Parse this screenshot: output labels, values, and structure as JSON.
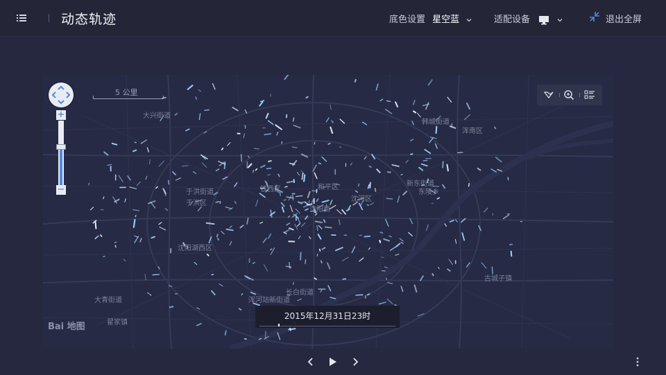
{
  "header": {
    "title": "动态轨迹",
    "bg_setting_label": "底色设置",
    "bg_setting_value": "星空蓝",
    "device_label": "适配设备",
    "exit_label": "退出全屏"
  },
  "map": {
    "scale_label": "5 公里",
    "districts": [
      {
        "key": "d1",
        "name": "大兴街道"
      },
      {
        "key": "d2",
        "name": "韩城街道"
      },
      {
        "key": "d3",
        "name": "浑南区"
      },
      {
        "key": "d4",
        "name": "于洪街道"
      },
      {
        "key": "d5",
        "name": "于洪区"
      },
      {
        "key": "d6",
        "name": "铁西区"
      },
      {
        "key": "d7",
        "name": "和平区"
      },
      {
        "key": "d8",
        "name": "沈阳南"
      },
      {
        "key": "d9",
        "name": "沈河区"
      },
      {
        "key": "d10",
        "name": "新东街道"
      },
      {
        "key": "d11",
        "name": "东陵乡"
      },
      {
        "key": "d12",
        "name": "沈阳湖西区"
      },
      {
        "key": "d13",
        "name": "长白街道"
      },
      {
        "key": "d14",
        "name": "浑河站新街道"
      },
      {
        "key": "d15",
        "name": "大青街道"
      },
      {
        "key": "d16",
        "name": "翟家镇"
      },
      {
        "key": "d17",
        "name": "古城子镇"
      }
    ],
    "time_label": "2015年12月31日23时",
    "logo_text": "Bai 地图"
  },
  "colors": {
    "background": "#262840",
    "header": "#242638",
    "map_bg": "#262a44",
    "road": "#363b59",
    "trail": "#9fd0ff"
  },
  "icons": {
    "menu": "list-menu-icon",
    "bg_dropdown": "chevron-down-icon",
    "device": "monitor-icon",
    "exit": "exit-fullscreen-icon",
    "prev": "chevron-left-icon",
    "play": "play-icon",
    "next": "chevron-right-icon",
    "more": "more-vertical-icon"
  }
}
